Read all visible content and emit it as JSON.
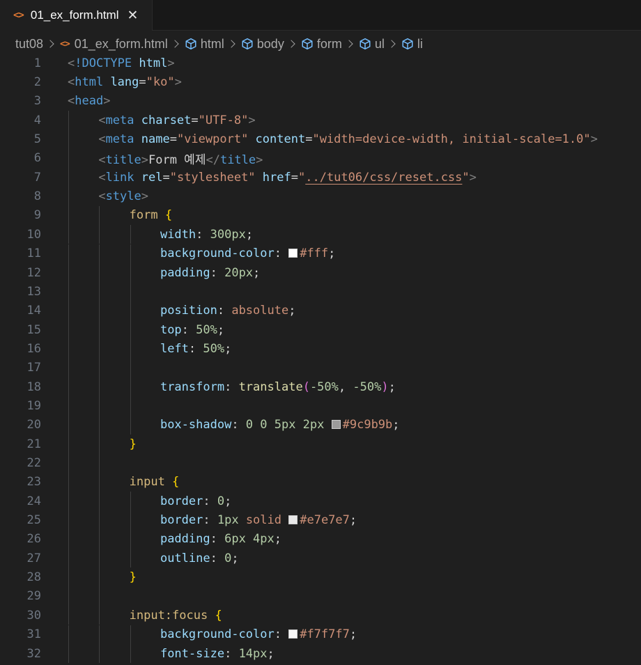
{
  "tab": {
    "icon": "<>",
    "label": "01_ex_form.html",
    "close": "✕"
  },
  "breadcrumb": [
    {
      "label": "tut08",
      "icon": "none"
    },
    {
      "label": "01_ex_form.html",
      "icon": "html-file-icon"
    },
    {
      "label": "html",
      "icon": "element-cube-icon"
    },
    {
      "label": "body",
      "icon": "element-cube-icon"
    },
    {
      "label": "form",
      "icon": "element-cube-icon"
    },
    {
      "label": "ul",
      "icon": "element-cube-icon"
    },
    {
      "label": "li",
      "icon": "element-cube-icon"
    }
  ],
  "colors": {
    "background": "#1f1f1f",
    "tag": "#569cd6",
    "attribute": "#9cdcfe",
    "string": "#ce9178",
    "number": "#b5cea8",
    "selector": "#d7ba7d",
    "brace": "#ffd700",
    "function": "#dcdcaa",
    "line_number": "#6e7681"
  },
  "lines": [
    {
      "n": "1",
      "indent": 0,
      "tokens": [
        [
          "t-bracket",
          "<"
        ],
        [
          "t-tag",
          "!DOCTYPE "
        ],
        [
          "t-attr",
          "html"
        ],
        [
          "t-bracket",
          ">"
        ]
      ]
    },
    {
      "n": "2",
      "indent": 0,
      "tokens": [
        [
          "t-bracket",
          "<"
        ],
        [
          "t-tag",
          "html "
        ],
        [
          "t-attr",
          "lang"
        ],
        [
          "t-eq",
          "="
        ],
        [
          "t-str",
          "\"ko\""
        ],
        [
          "t-bracket",
          ">"
        ]
      ]
    },
    {
      "n": "3",
      "indent": 0,
      "tokens": [
        [
          "t-bracket",
          "<"
        ],
        [
          "t-tag",
          "head"
        ],
        [
          "t-bracket",
          ">"
        ]
      ]
    },
    {
      "n": "4",
      "indent": 1,
      "tokens": [
        [
          "t-bracket",
          "<"
        ],
        [
          "t-tag",
          "meta "
        ],
        [
          "t-attr",
          "charset"
        ],
        [
          "t-eq",
          "="
        ],
        [
          "t-str",
          "\"UTF-8\""
        ],
        [
          "t-bracket",
          ">"
        ]
      ]
    },
    {
      "n": "5",
      "indent": 1,
      "tokens": [
        [
          "t-bracket",
          "<"
        ],
        [
          "t-tag",
          "meta "
        ],
        [
          "t-attr",
          "name"
        ],
        [
          "t-eq",
          "="
        ],
        [
          "t-str",
          "\"viewport\" "
        ],
        [
          "t-attr",
          "content"
        ],
        [
          "t-eq",
          "="
        ],
        [
          "t-str",
          "\"width=device-width, initial-scale=1.0\""
        ],
        [
          "t-bracket",
          ">"
        ]
      ]
    },
    {
      "n": "6",
      "indent": 1,
      "tokens": [
        [
          "t-bracket",
          "<"
        ],
        [
          "t-tag",
          "title"
        ],
        [
          "t-bracket",
          ">"
        ],
        [
          "t-text",
          "Form 예제"
        ],
        [
          "t-bracket",
          "</"
        ],
        [
          "t-tag",
          "title"
        ],
        [
          "t-bracket",
          ">"
        ]
      ]
    },
    {
      "n": "7",
      "indent": 1,
      "tokens": [
        [
          "t-bracket",
          "<"
        ],
        [
          "t-tag",
          "link "
        ],
        [
          "t-attr",
          "rel"
        ],
        [
          "t-eq",
          "="
        ],
        [
          "t-str",
          "\"stylesheet\" "
        ],
        [
          "t-attr",
          "href"
        ],
        [
          "t-eq",
          "="
        ],
        [
          "t-str",
          "\""
        ],
        [
          "t-link",
          "../tut06/css/reset.css"
        ],
        [
          "t-str",
          "\""
        ],
        [
          "t-bracket",
          ">"
        ]
      ]
    },
    {
      "n": "8",
      "indent": 1,
      "tokens": [
        [
          "t-bracket",
          "<"
        ],
        [
          "t-tag",
          "style"
        ],
        [
          "t-bracket",
          ">"
        ]
      ]
    },
    {
      "n": "9",
      "indent": 2,
      "tokens": [
        [
          "t-sel",
          "form "
        ],
        [
          "t-brace",
          "{"
        ]
      ]
    },
    {
      "n": "10",
      "indent": 3,
      "tokens": [
        [
          "t-prop",
          "width"
        ],
        [
          "t-punc",
          ": "
        ],
        [
          "t-num",
          "300px"
        ],
        [
          "t-punc",
          ";"
        ]
      ]
    },
    {
      "n": "11",
      "indent": 3,
      "tokens": [
        [
          "t-prop",
          "background-color"
        ],
        [
          "t-punc",
          ": "
        ],
        [
          "swatch",
          "#ffffff"
        ],
        [
          "t-str",
          "#fff"
        ],
        [
          "t-punc",
          ";"
        ]
      ]
    },
    {
      "n": "12",
      "indent": 3,
      "tokens": [
        [
          "t-prop",
          "padding"
        ],
        [
          "t-punc",
          ": "
        ],
        [
          "t-num",
          "20px"
        ],
        [
          "t-punc",
          ";"
        ]
      ]
    },
    {
      "n": "13",
      "indent": 3,
      "tokens": []
    },
    {
      "n": "14",
      "indent": 3,
      "tokens": [
        [
          "t-prop",
          "position"
        ],
        [
          "t-punc",
          ": "
        ],
        [
          "t-kw",
          "absolute"
        ],
        [
          "t-punc",
          ";"
        ]
      ]
    },
    {
      "n": "15",
      "indent": 3,
      "tokens": [
        [
          "t-prop",
          "top"
        ],
        [
          "t-punc",
          ": "
        ],
        [
          "t-num",
          "50%"
        ],
        [
          "t-punc",
          ";"
        ]
      ]
    },
    {
      "n": "16",
      "indent": 3,
      "tokens": [
        [
          "t-prop",
          "left"
        ],
        [
          "t-punc",
          ": "
        ],
        [
          "t-num",
          "50%"
        ],
        [
          "t-punc",
          ";"
        ]
      ]
    },
    {
      "n": "17",
      "indent": 3,
      "tokens": []
    },
    {
      "n": "18",
      "indent": 3,
      "tokens": [
        [
          "t-prop",
          "transform"
        ],
        [
          "t-punc",
          ": "
        ],
        [
          "t-fn",
          "translate"
        ],
        [
          "t-paren",
          "("
        ],
        [
          "t-num",
          "-50%"
        ],
        [
          "t-punc",
          ", "
        ],
        [
          "t-num",
          "-50%"
        ],
        [
          "t-paren",
          ")"
        ],
        [
          "t-punc",
          ";"
        ]
      ]
    },
    {
      "n": "19",
      "indent": 3,
      "tokens": []
    },
    {
      "n": "20",
      "indent": 3,
      "tokens": [
        [
          "t-prop",
          "box-shadow"
        ],
        [
          "t-punc",
          ": "
        ],
        [
          "t-num",
          "0 0 5px 2px "
        ],
        [
          "swatch",
          "#9c9b9b"
        ],
        [
          "t-str",
          "#9c9b9b"
        ],
        [
          "t-punc",
          ";"
        ]
      ]
    },
    {
      "n": "21",
      "indent": 2,
      "tokens": [
        [
          "t-brace",
          "}"
        ]
      ]
    },
    {
      "n": "22",
      "indent": 2,
      "tokens": []
    },
    {
      "n": "23",
      "indent": 2,
      "tokens": [
        [
          "t-sel",
          "input "
        ],
        [
          "t-brace",
          "{"
        ]
      ]
    },
    {
      "n": "24",
      "indent": 3,
      "tokens": [
        [
          "t-prop",
          "border"
        ],
        [
          "t-punc",
          ": "
        ],
        [
          "t-num",
          "0"
        ],
        [
          "t-punc",
          ";"
        ]
      ]
    },
    {
      "n": "25",
      "indent": 3,
      "tokens": [
        [
          "t-prop",
          "border"
        ],
        [
          "t-punc",
          ": "
        ],
        [
          "t-num",
          "1px "
        ],
        [
          "t-kw",
          "solid "
        ],
        [
          "swatch",
          "#e7e7e7"
        ],
        [
          "t-str",
          "#e7e7e7"
        ],
        [
          "t-punc",
          ";"
        ]
      ]
    },
    {
      "n": "26",
      "indent": 3,
      "tokens": [
        [
          "t-prop",
          "padding"
        ],
        [
          "t-punc",
          ": "
        ],
        [
          "t-num",
          "6px 4px"
        ],
        [
          "t-punc",
          ";"
        ]
      ]
    },
    {
      "n": "27",
      "indent": 3,
      "tokens": [
        [
          "t-prop",
          "outline"
        ],
        [
          "t-punc",
          ": "
        ],
        [
          "t-num",
          "0"
        ],
        [
          "t-punc",
          ";"
        ]
      ]
    },
    {
      "n": "28",
      "indent": 2,
      "tokens": [
        [
          "t-brace",
          "}"
        ]
      ]
    },
    {
      "n": "29",
      "indent": 2,
      "tokens": []
    },
    {
      "n": "30",
      "indent": 2,
      "tokens": [
        [
          "t-sel",
          "input:focus "
        ],
        [
          "t-brace",
          "{"
        ]
      ]
    },
    {
      "n": "31",
      "indent": 3,
      "tokens": [
        [
          "t-prop",
          "background-color"
        ],
        [
          "t-punc",
          ": "
        ],
        [
          "swatch",
          "#f7f7f7"
        ],
        [
          "t-str",
          "#f7f7f7"
        ],
        [
          "t-punc",
          ";"
        ]
      ]
    },
    {
      "n": "32",
      "indent": 3,
      "tokens": [
        [
          "t-prop",
          "font-size"
        ],
        [
          "t-punc",
          ": "
        ],
        [
          "t-num",
          "14px"
        ],
        [
          "t-punc",
          ";"
        ]
      ]
    }
  ]
}
